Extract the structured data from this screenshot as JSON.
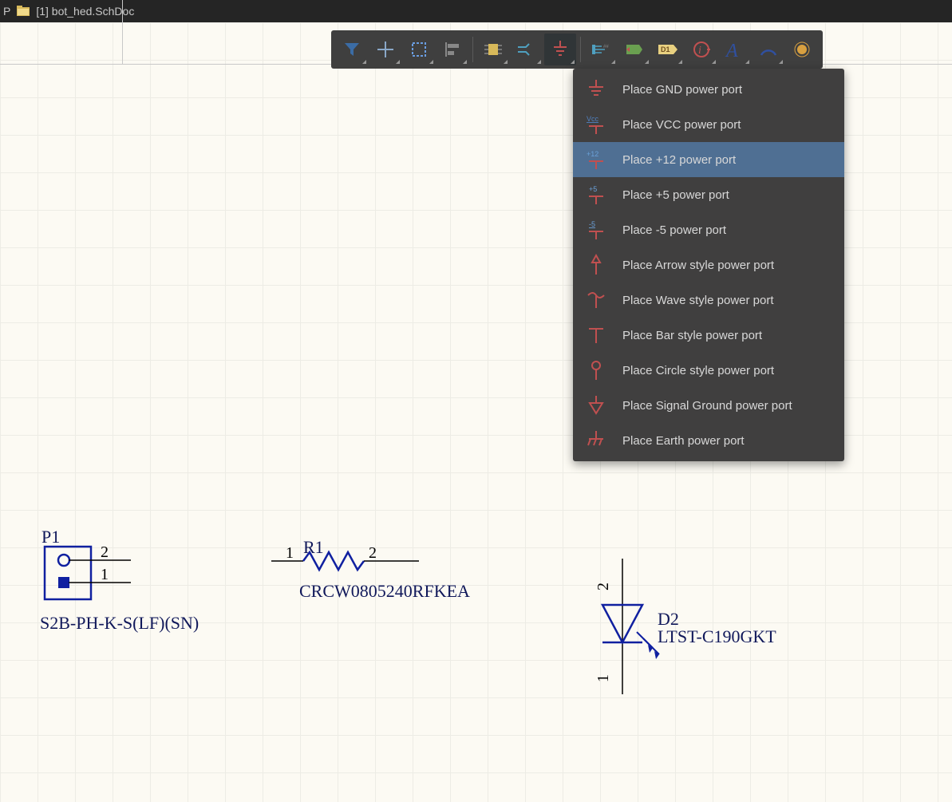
{
  "titlebar": {
    "p": "P",
    "tab": "[1] bot_hed.SchDoc"
  },
  "toolbar": {
    "buttons": [
      {
        "name": "filter-icon"
      },
      {
        "name": "move-icon"
      },
      {
        "name": "selection-icon"
      },
      {
        "name": "align-icon"
      },
      {
        "name": "component-icon"
      },
      {
        "name": "bus-icon"
      },
      {
        "name": "power-port-icon"
      },
      {
        "name": "harness-icon"
      },
      {
        "name": "net-icon"
      },
      {
        "name": "designator-icon"
      },
      {
        "name": "probe-icon"
      },
      {
        "name": "text-icon"
      },
      {
        "name": "arc-icon"
      },
      {
        "name": "dot-icon"
      }
    ]
  },
  "menu": {
    "items": [
      {
        "label": "Place GND power port",
        "icon": "gnd"
      },
      {
        "label": "Place VCC power port",
        "icon": "vcc"
      },
      {
        "label": "Place +12 power port",
        "icon": "p12",
        "selected": true
      },
      {
        "label": "Place +5 power port",
        "icon": "p5"
      },
      {
        "label": "Place -5 power port",
        "icon": "m5"
      },
      {
        "label": "Place Arrow style power port",
        "icon": "arrow"
      },
      {
        "label": "Place Wave style power port",
        "icon": "wave"
      },
      {
        "label": "Place Bar style power port",
        "icon": "bar"
      },
      {
        "label": "Place Circle style power port",
        "icon": "circle"
      },
      {
        "label": "Place Signal Ground power port",
        "icon": "sig"
      },
      {
        "label": "Place Earth power port",
        "icon": "earth"
      }
    ]
  },
  "schematic": {
    "p1": {
      "ref": "P1",
      "value": "S2B-PH-K-S(LF)(SN)",
      "pin1": "1",
      "pin2": "2"
    },
    "r1": {
      "ref": "R1",
      "value": "CRCW0805240RFKEA",
      "pin1": "1",
      "pin2": "2"
    },
    "d2": {
      "ref": "D2",
      "value": "LTST-C190GKT",
      "pin1": "1",
      "pin2": "2"
    }
  }
}
